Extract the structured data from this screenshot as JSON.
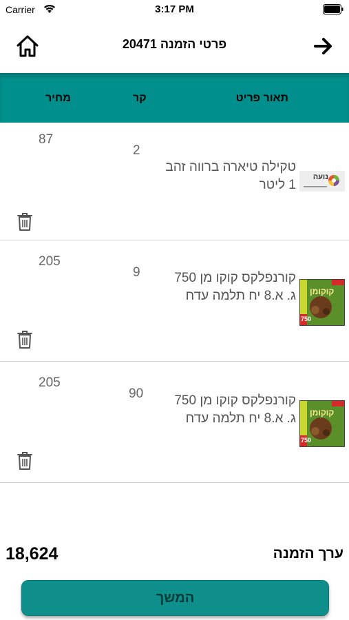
{
  "status_bar": {
    "carrier": "Carrier",
    "time": "3:17 PM"
  },
  "header": {
    "title": "פרטי הזמנה 20471"
  },
  "table": {
    "col_desc": "תאור פריט",
    "col_qty": "קר",
    "col_price": "מחיר"
  },
  "items": [
    {
      "description": "טקילה טיארה ברווה זהב 1 ליטר",
      "quantity": "2",
      "price": "87",
      "thumb_text": "נועה"
    },
    {
      "description": "קורנפלקס קוקו מן 750 ג. א.8 יח תלמה עדח",
      "quantity": "9",
      "price": "205",
      "thumb_text": "קוקומן",
      "thumb_weight": "750"
    },
    {
      "description": "קורנפלקס קוקו מן 750 ג. א.8 יח תלמה עדח",
      "quantity": "90",
      "price": "205",
      "thumb_text": "קוקומן",
      "thumb_weight": "750"
    }
  ],
  "footer": {
    "total_label": "ערך הזמנה",
    "total_value": "18,624",
    "continue_label": "המשך"
  },
  "colors": {
    "accent": "#008f8c",
    "button": "#0f8f8b"
  }
}
